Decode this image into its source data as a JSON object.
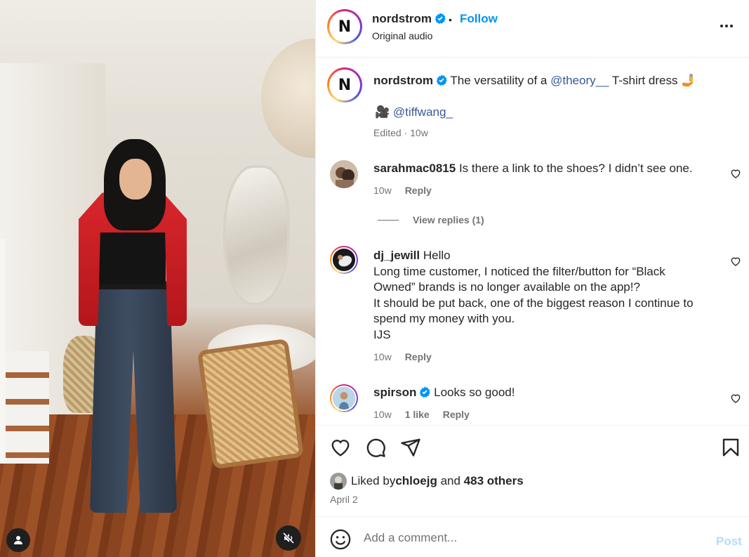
{
  "header": {
    "username": "nordstrom",
    "logo_letter": "N",
    "separator": "•",
    "follow_label": "Follow",
    "audio": "Original audio",
    "more_icon": "more-horizontal-icon"
  },
  "caption": {
    "username": "nordstrom",
    "text_before": "The versatility of a ",
    "mention": "@theory__",
    "text_after": " T-shirt dress",
    "emoji": "🤳",
    "credit_icon": "🎥",
    "credit_mention": "@tiffwang_",
    "meta": "Edited · 10w"
  },
  "comments": [
    {
      "username": "sarahmac0815",
      "text": "Is there a link to the shoes? I didn’t see one.",
      "time": "10w",
      "likes": "",
      "reply_label": "Reply"
    },
    {
      "username": "dj_jewill",
      "text": "Hello",
      "lines": [
        "Long time customer, I noticed the filter/button for “Black",
        "Owned” brands is no longer available on the app!?",
        "It should be put back, one of the biggest reason I continue to",
        "spend my money with you.",
        "IJS"
      ],
      "time": "10w",
      "reply_label": "Reply"
    },
    {
      "username": "spirson",
      "text": "Looks so good!",
      "time": "10w",
      "likes": "1 like",
      "reply_label": "Reply"
    }
  ],
  "view_replies": "View replies (1)",
  "likes": {
    "prefix": "Liked by ",
    "user": "chloejg",
    "middle": " and ",
    "others": "483 others"
  },
  "date": "April 2",
  "add_comment": {
    "placeholder": "Add a comment...",
    "post_label": "Post"
  },
  "colors": {
    "link_blue": "#0095f6",
    "mention": "#385898",
    "muted": "#737373",
    "post_disabled": "#b3dbff"
  }
}
